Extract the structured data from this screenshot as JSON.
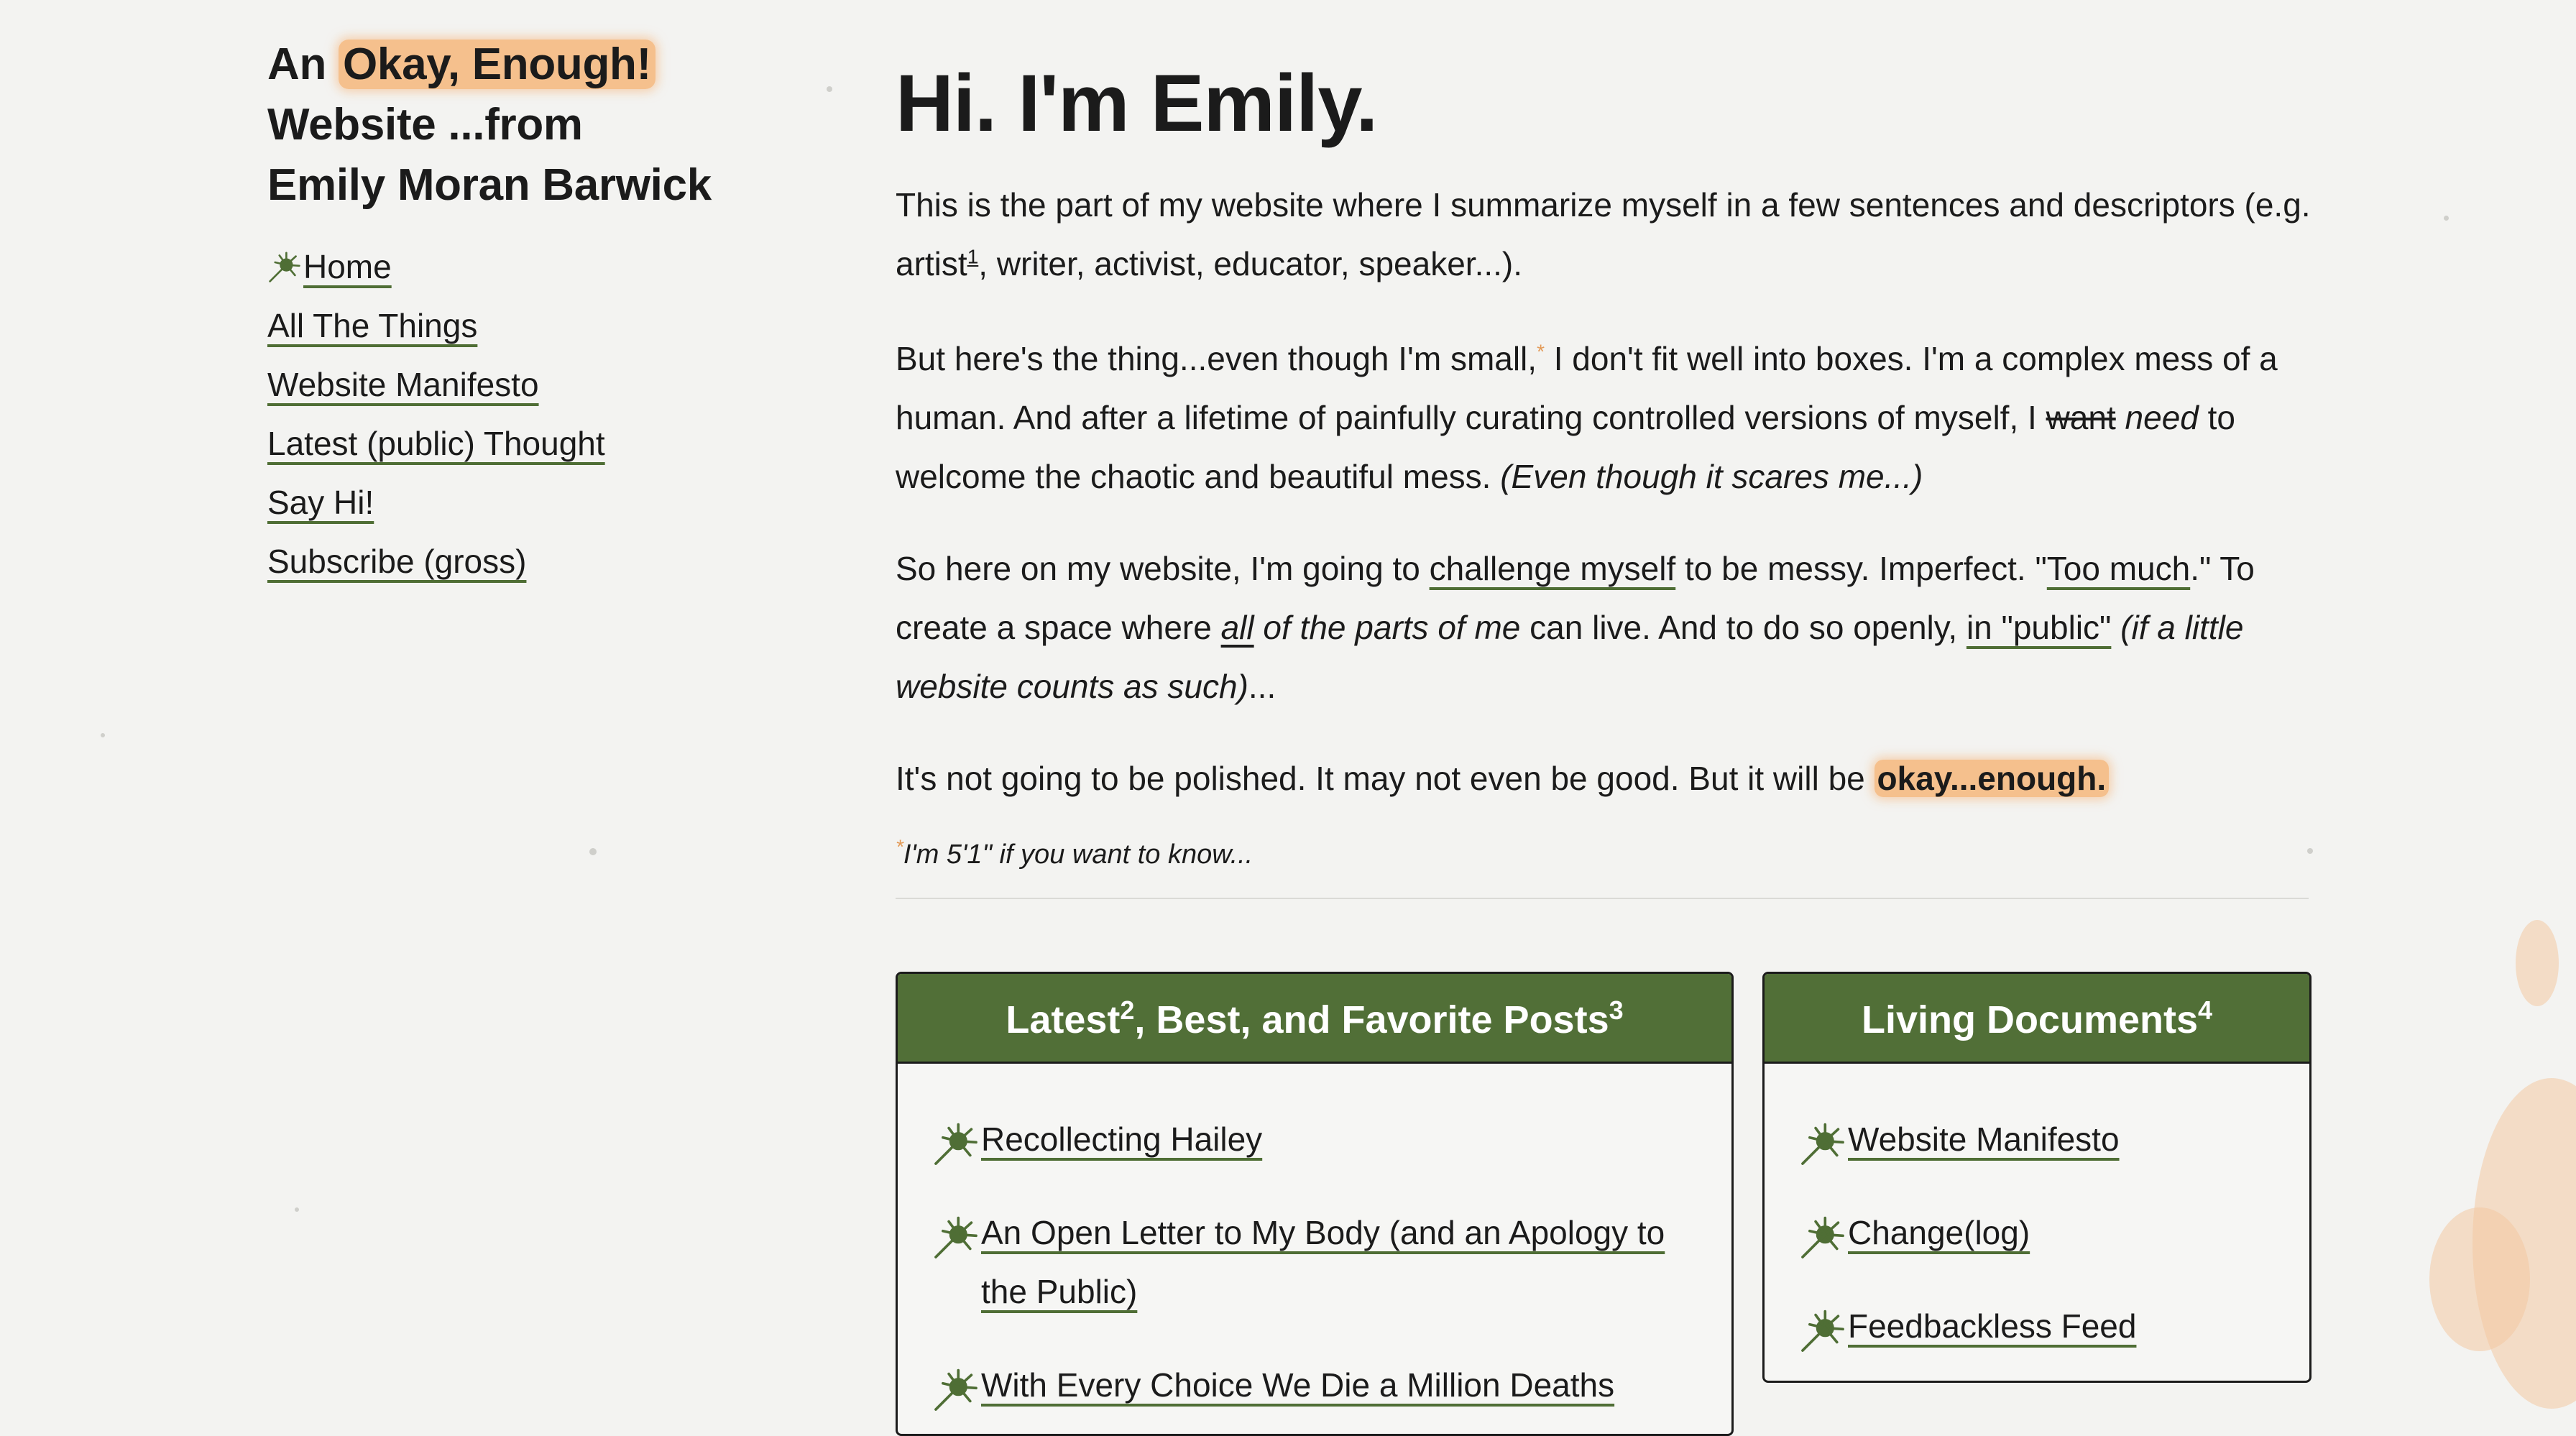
{
  "site_title": {
    "prefix": "An ",
    "highlight": "Okay, Enough!",
    "line2": "Website ...from",
    "line3": "Emily Moran Barwick"
  },
  "nav": {
    "items": [
      {
        "label": "Home",
        "current": true
      },
      {
        "label": "All The Things"
      },
      {
        "label": "Website Manifesto"
      },
      {
        "label": "Latest (public) Thought"
      },
      {
        "label": "Say Hi!"
      },
      {
        "label": "Subscribe (gross)"
      }
    ]
  },
  "main": {
    "heading": "Hi. I'm Emily.",
    "p1": {
      "a": "This is the part of my website where I summarize myself in a few sentences and descriptors (e.g. artist",
      "sup": "1",
      "b": ", writer, activist, educator, speaker...)."
    },
    "p2": {
      "a": "But here's the thing...even though I'm small,",
      "sup": "*",
      "b": " I don't fit well into boxes. I'm a complex mess of a human. And after a lifetime of painfully curating controlled versions of myself, I ",
      "strike": "want",
      "b2": " ",
      "em": "need",
      "c": " to welcome the chaotic and beautiful mess. ",
      "em2": "(Even though it scares me...)"
    },
    "p3": {
      "a": "So here on my website, I'm going to ",
      "link1": "challenge myself",
      "b": " to be messy. Imperfect. \"",
      "link2": "Too much",
      "c": ".\" To create a space where ",
      "em_u": "all",
      "em": " of the parts of me",
      "d": " can live. And to do so openly, ",
      "link3": "in \"public\"",
      "e": " ",
      "em2": "(if a little website counts as such)",
      "f": "..."
    },
    "p4": {
      "a": "It's not going to be polished. It may not even be good. But it will be ",
      "bold": "okay...enough."
    },
    "footnote": {
      "mark": "*",
      "text": "I'm 5'1\" if you want to know..."
    }
  },
  "latest_box": {
    "title": "Latest",
    "sup1": "2",
    "title2": ", Best, and Favorite Posts",
    "sup2": "3",
    "items": [
      {
        "label": "Recollecting Hailey"
      },
      {
        "label": "An Open Letter to My Body (and an Apology to the Public)"
      },
      {
        "label": "With Every Choice We Die a Million Deaths"
      }
    ]
  },
  "living_box": {
    "title": "Living Documents",
    "sup": "4",
    "items": [
      {
        "label": "Website Manifesto"
      },
      {
        "label": "Change(log)"
      },
      {
        "label": "Feedbackless Feed"
      }
    ]
  },
  "colors": {
    "accent_green": "#516f37",
    "highlight_orange": "#f5c08d",
    "background": "#f3f3f1"
  },
  "icons": {
    "bullet": "splat-icon"
  }
}
